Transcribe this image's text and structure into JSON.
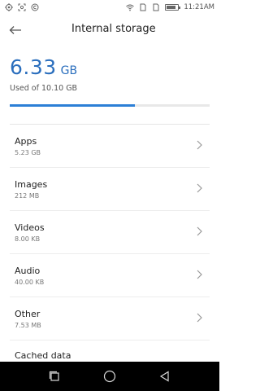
{
  "status_bar": {
    "time": "11:21AM",
    "left_icons": [
      "location-icon",
      "screenshot-icon",
      "copyright-icon"
    ],
    "right_icons": [
      "wifi-icon",
      "sim1-icon",
      "sim2-icon",
      "battery-icon"
    ],
    "battery_level": 0.85
  },
  "app_bar": {
    "title": "Internal storage",
    "back_icon": "arrow-left-icon"
  },
  "summary": {
    "used_value": "6.33",
    "used_unit": "GB",
    "used_of_text": "Used of 10.10 GB",
    "used_fraction": 0.627
  },
  "storage_items": [
    {
      "name": "Apps",
      "size": "5.23 GB"
    },
    {
      "name": "Images",
      "size": "212 MB"
    },
    {
      "name": "Videos",
      "size": "8.00 KB"
    },
    {
      "name": "Audio",
      "size": "40.00 KB"
    },
    {
      "name": "Other",
      "size": "7.53 MB"
    }
  ],
  "partial_item": {
    "name": "Cached data"
  },
  "nav_bar": {
    "icons": [
      "recents-icon",
      "home-icon",
      "back-triangle-icon"
    ]
  },
  "colors": {
    "accent": "#2c7fd6",
    "value_text": "#2a6ebd",
    "nav_bg": "#000000"
  }
}
